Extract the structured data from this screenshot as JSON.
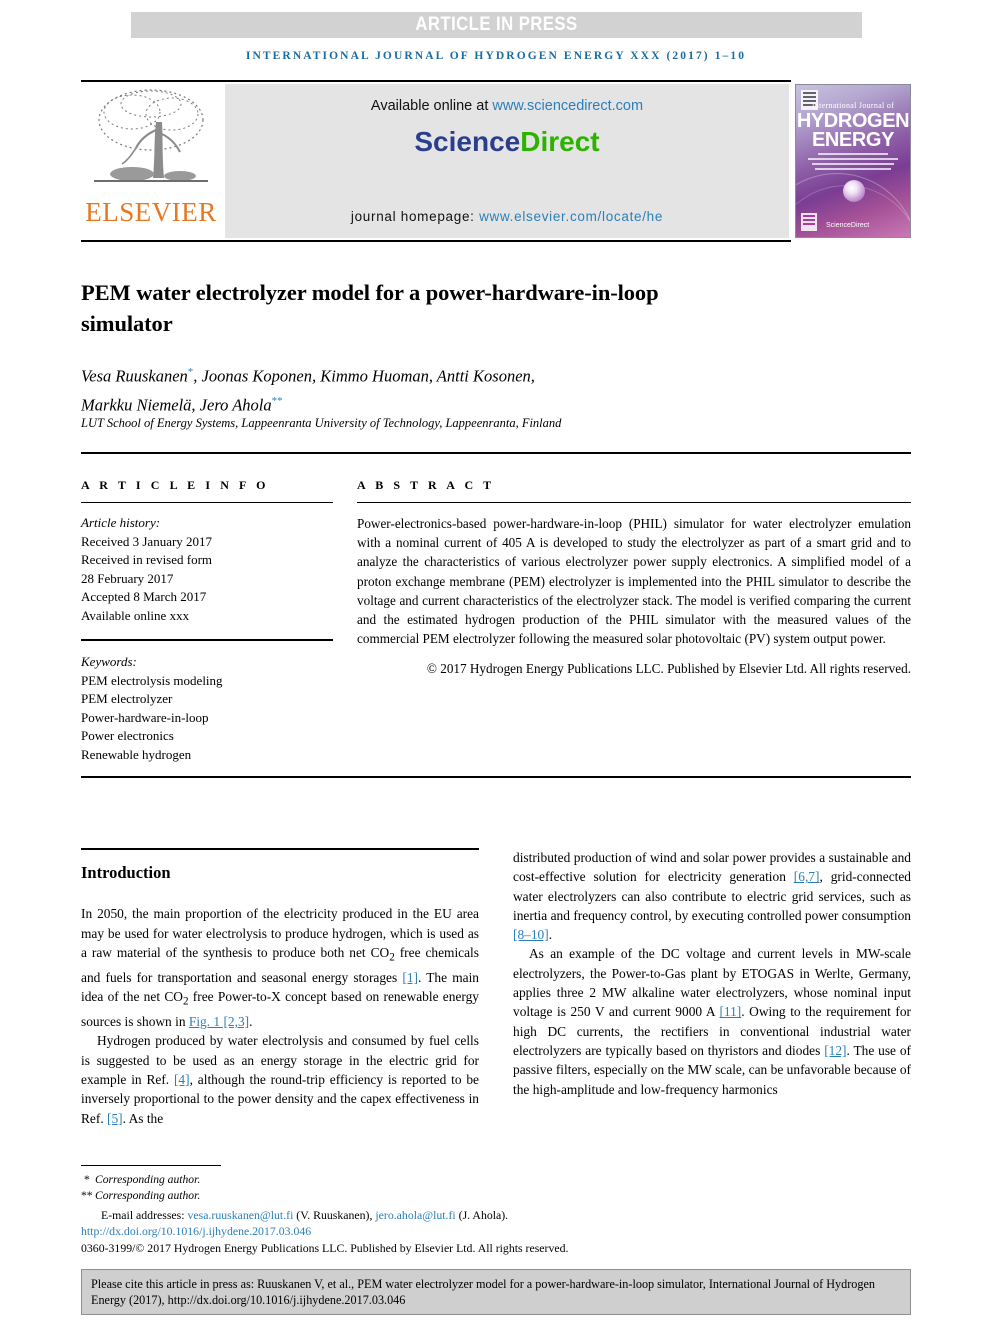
{
  "banner": {
    "text": "ARTICLE IN PRESS",
    "bg_color": "#d2d2d2"
  },
  "running_head": {
    "text": "INTERNATIONAL JOURNAL OF HYDROGEN ENERGY XXX (2017) 1–10",
    "color": "#1a6ba0"
  },
  "masthead": {
    "publisher_name": "ELSEVIER",
    "publisher_color": "#e87722",
    "publisher_icon": "elsevier-tree-logo",
    "available_prefix": "Available online at ",
    "available_url": "www.sciencedirect.com",
    "sciencedirect_part1": "Science",
    "sciencedirect_part2": "Direct",
    "sciencedirect_color1": "#2b3d8f",
    "sciencedirect_color2": "#2db200",
    "homepage_prefix": "journal homepage: ",
    "homepage_url": "www.elsevier.com/locate/he",
    "cover": {
      "line_small": "International Journal of",
      "line_big1": "HYDROGEN",
      "line_big2": "ENERGY",
      "footer_mark": "ScienceDirect"
    }
  },
  "article": {
    "title": "PEM water electrolyzer model for a power-hardware-in-loop simulator",
    "authors_line1": "Vesa Ruuskanen",
    "authors_line1_rest": ", Joonas Koponen, Kimmo Huoman, Antti Kosonen,",
    "authors_line2": "Markku Niemelä, Jero Ahola",
    "author_mark1": "*",
    "author_mark2": "**",
    "affiliation": "LUT School of Energy Systems, Lappeenranta University of Technology, Lappeenranta, Finland"
  },
  "article_info": {
    "heading": "A R T I C L E   I N F O",
    "history_label": "Article history:",
    "history": [
      "Received 3 January 2017",
      "Received in revised form",
      "28 February 2017",
      "Accepted 8 March 2017",
      "Available online xxx"
    ],
    "keywords_label": "Keywords:",
    "keywords": [
      "PEM electrolysis modeling",
      "PEM electrolyzer",
      "Power-hardware-in-loop",
      "Power electronics",
      "Renewable hydrogen"
    ]
  },
  "abstract": {
    "heading": "A B S T R A C T",
    "body": "Power-electronics-based power-hardware-in-loop (PHIL) simulator for water electrolyzer emulation with a nominal current of 405 A is developed to study the electrolyzer as part of a smart grid and to analyze the characteristics of various electrolyzer power supply electronics. A simplified model of a proton exchange membrane (PEM) electrolyzer is implemented into the PHIL simulator to describe the voltage and current characteristics of the electrolyzer stack. The model is verified comparing the current and the estimated hydrogen production of the PHIL simulator with the measured values of the commercial PEM electrolyzer following the measured solar photovoltaic (PV) system output power.",
    "copyright": "© 2017 Hydrogen Energy Publications LLC. Published by Elsevier Ltd. All rights reserved."
  },
  "introduction": {
    "heading": "Introduction",
    "left_para1_a": "In 2050, the main proportion of the electricity produced in the EU area may be used for water electrolysis to produce hydrogen, which is used as a raw material of the synthesis to produce both net CO",
    "left_para1_sub": "2",
    "left_para1_b": " free chemicals and fuels for transportation and seasonal energy storages ",
    "left_para1_ref1": "[1]",
    "left_para1_c": ". The main idea of the net CO",
    "left_para1_sub2": "2",
    "left_para1_d": " free Power-to-X concept based on renewable energy sources is shown in ",
    "left_para1_ref2": "Fig. 1 [2,3]",
    "left_para1_e": ".",
    "left_para2_a": "Hydrogen produced by water electrolysis and consumed by fuel cells is suggested to be used as an energy storage in the electric grid for example in Ref. ",
    "left_para2_ref1": "[4]",
    "left_para2_b": ", although the round-trip efficiency is reported to be inversely proportional to the power density and the capex effectiveness in Ref. ",
    "left_para2_ref2": "[5]",
    "left_para2_c": ". As the",
    "right_para1_a": "distributed production of wind and solar power provides a sustainable and cost-effective solution for electricity generation ",
    "right_para1_ref1": "[6,7]",
    "right_para1_b": ", grid-connected water electrolyzers can also contribute to electric grid services, such as inertia and frequency control, by executing controlled power consumption ",
    "right_para1_ref2": "[8–10]",
    "right_para1_c": ".",
    "right_para2_a": "As an example of the DC voltage and current levels in MW-scale electrolyzers, the Power-to-Gas plant by ETOGAS in Werlte, Germany, applies three 2 MW alkaline water electrolyzers, whose nominal input voltage is 250 V and current 9000 A ",
    "right_para2_ref1": "[11]",
    "right_para2_b": ". Owing to the requirement for high DC currents, the rectifiers in conventional industrial water electrolyzers are typically based on thyristors and diodes ",
    "right_para2_ref2": "[12]",
    "right_para2_c": ". The use of passive filters, especially on the MW scale, can be unfavorable because of the high-amplitude and low-frequency harmonics"
  },
  "footer": {
    "corresponding1": "Corresponding author.",
    "corresponding2": "Corresponding author.",
    "mark1": "*",
    "mark2": "**",
    "email_label": "E-mail addresses: ",
    "email1": "vesa.ruuskanen@lut.fi",
    "email1_name": " (V. Ruuskanen), ",
    "email2": "jero.ahola@lut.fi",
    "email2_name": " (J. Ahola).",
    "doi": "http://dx.doi.org/10.1016/j.ijhydene.2017.03.046",
    "issn_line": "0360-3199/© 2017 Hydrogen Energy Publications LLC. Published by Elsevier Ltd. All rights reserved.",
    "cite_text": "Please cite this article in press as: Ruuskanen V, et al., PEM water electrolyzer model for a power-hardware-in-loop simulator, International Journal of Hydrogen Energy (2017), http://dx.doi.org/10.1016/j.ijhydene.2017.03.046"
  }
}
